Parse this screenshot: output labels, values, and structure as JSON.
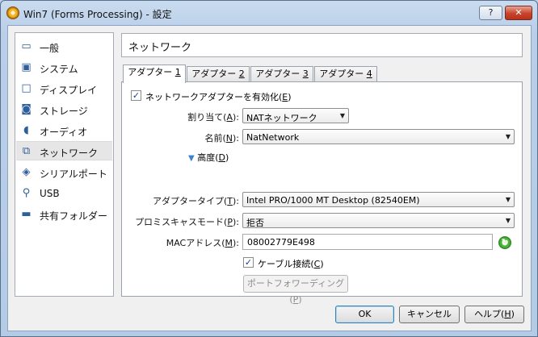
{
  "window": {
    "title": "Win7 (Forms Processing) - 設定",
    "help_label": "?",
    "close_label": "✕"
  },
  "sidebar": {
    "items": [
      {
        "label": "一般",
        "icon": "general-icon"
      },
      {
        "label": "システム",
        "icon": "system-icon"
      },
      {
        "label": "ディスプレイ",
        "icon": "display-icon"
      },
      {
        "label": "ストレージ",
        "icon": "storage-icon"
      },
      {
        "label": "オーディオ",
        "icon": "audio-icon"
      },
      {
        "label": "ネットワーク",
        "icon": "network-icon",
        "selected": true
      },
      {
        "label": "シリアルポート",
        "icon": "serial-port-icon"
      },
      {
        "label": "USB",
        "icon": "usb-icon"
      },
      {
        "label": "共有フォルダー",
        "icon": "shared-folder-icon"
      }
    ]
  },
  "page": {
    "title": "ネットワーク"
  },
  "tabs": [
    {
      "label": "アダプター ",
      "key": "1",
      "active": true
    },
    {
      "label": "アダプター ",
      "key": "2"
    },
    {
      "label": "アダプター ",
      "key": "3"
    },
    {
      "label": "アダプター ",
      "key": "4"
    }
  ],
  "adapter": {
    "enable_label": "ネットワークアダプターを有効化(",
    "enable_key": "E",
    "enable_suffix": ")",
    "enable_checked": true,
    "attached_label": "割り当て(",
    "attached_key": "A",
    "attached_suffix": "):",
    "attached_value": "NATネットワーク",
    "name_label": "名前(",
    "name_key": "N",
    "name_suffix": "):",
    "name_value": "NatNetwork",
    "advanced_label": "高度(",
    "advanced_key": "D",
    "advanced_suffix": ")",
    "type_label": "アダプタータイプ(",
    "type_key": "T",
    "type_suffix": "):",
    "type_value": "Intel PRO/1000 MT Desktop (82540EM)",
    "promisc_label": "プロミスキャスモード(",
    "promisc_key": "P",
    "promisc_suffix": "):",
    "promisc_value": "拒否",
    "mac_label": "MACアドレス(",
    "mac_key": "M",
    "mac_suffix": "):",
    "mac_value": "08002779E498",
    "cable_label": "ケーブル接続(",
    "cable_key": "C",
    "cable_suffix": ")",
    "cable_checked": true,
    "port_forwarding_label": "ポートフォワーディング(",
    "port_forwarding_key": "P",
    "port_forwarding_suffix": ")"
  },
  "buttons": {
    "ok": "OK",
    "cancel": "キャンセル",
    "help_prefix": "ヘルプ(",
    "help_key": "H",
    "help_suffix": ")"
  },
  "colors": {
    "titlebar": "#c9dbef",
    "selection": "#e6e6e6",
    "accent_arrow": "#3b83cf",
    "refresh_green": "#4bb33c"
  }
}
